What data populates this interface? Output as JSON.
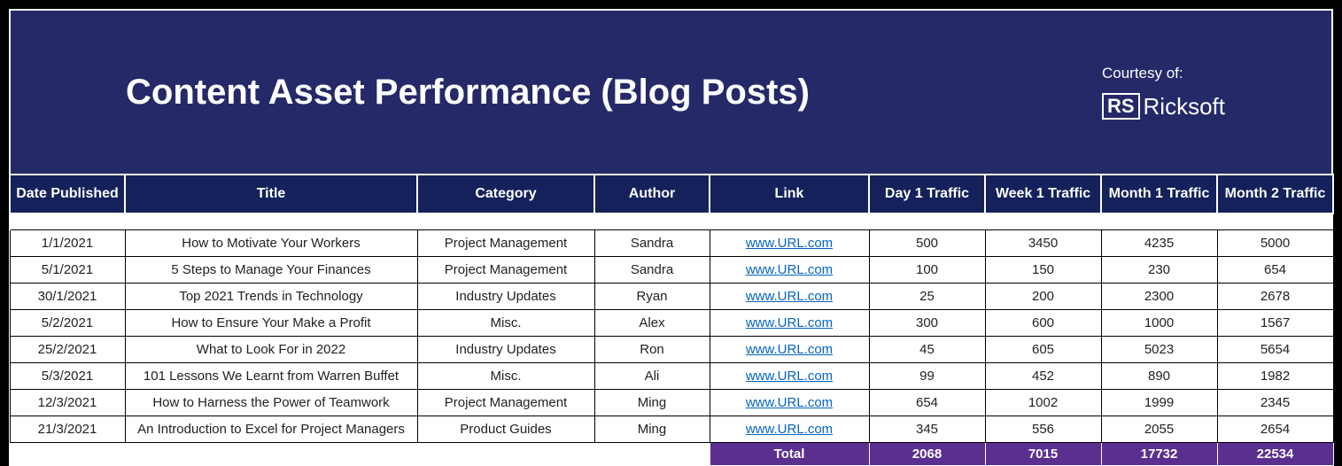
{
  "banner": {
    "title": "Content Asset Performance (Blog Posts)",
    "courtesy_label": "Courtesy of:",
    "logo_rs": "RS",
    "logo_text": "Ricksoft"
  },
  "columns": {
    "date": "Date Published",
    "title": "Title",
    "category": "Category",
    "author": "Author",
    "link": "Link",
    "day1": "Day 1 Traffic",
    "week1": "Week 1 Traffic",
    "month1": "Month 1 Traffic",
    "month2": "Month 2 Traffic"
  },
  "rows": [
    {
      "date": "1/1/2021",
      "title": "How to Motivate Your Workers",
      "category": "Project Management",
      "author": "Sandra",
      "link": "www.URL.com",
      "day1": "500",
      "week1": "3450",
      "month1": "4235",
      "month2": "5000"
    },
    {
      "date": "5/1/2021",
      "title": "5 Steps to Manage Your Finances",
      "category": "Project Management",
      "author": "Sandra",
      "link": "www.URL.com",
      "day1": "100",
      "week1": "150",
      "month1": "230",
      "month2": "654"
    },
    {
      "date": "30/1/2021",
      "title": "Top 2021 Trends in Technology",
      "category": "Industry Updates",
      "author": "Ryan",
      "link": "www.URL.com",
      "day1": "25",
      "week1": "200",
      "month1": "2300",
      "month2": "2678"
    },
    {
      "date": "5/2/2021",
      "title": "How to Ensure Your Make a Profit",
      "category": "Misc.",
      "author": "Alex",
      "link": "www.URL.com",
      "day1": "300",
      "week1": "600",
      "month1": "1000",
      "month2": "1567"
    },
    {
      "date": "25/2/2021",
      "title": "What to Look For in 2022",
      "category": "Industry Updates",
      "author": "Ron",
      "link": "www.URL.com",
      "day1": "45",
      "week1": "605",
      "month1": "5023",
      "month2": "5654"
    },
    {
      "date": "5/3/2021",
      "title": "101 Lessons We Learnt from Warren Buffet",
      "category": "Misc.",
      "author": "Ali",
      "link": "www.URL.com",
      "day1": "99",
      "week1": "452",
      "month1": "890",
      "month2": "1982"
    },
    {
      "date": "12/3/2021",
      "title": "How to Harness the Power of Teamwork",
      "category": "Project Management",
      "author": "Ming",
      "link": "www.URL.com",
      "day1": "654",
      "week1": "1002",
      "month1": "1999",
      "month2": "2345"
    },
    {
      "date": "21/3/2021",
      "title": "An Introduction to Excel for Project Managers",
      "category": "Product Guides",
      "author": "Ming",
      "link": "www.URL.com",
      "day1": "345",
      "week1": "556",
      "month1": "2055",
      "month2": "2654"
    }
  ],
  "total": {
    "label": "Total",
    "day1": "2068",
    "week1": "7015",
    "month1": "17732",
    "month2": "22534"
  }
}
